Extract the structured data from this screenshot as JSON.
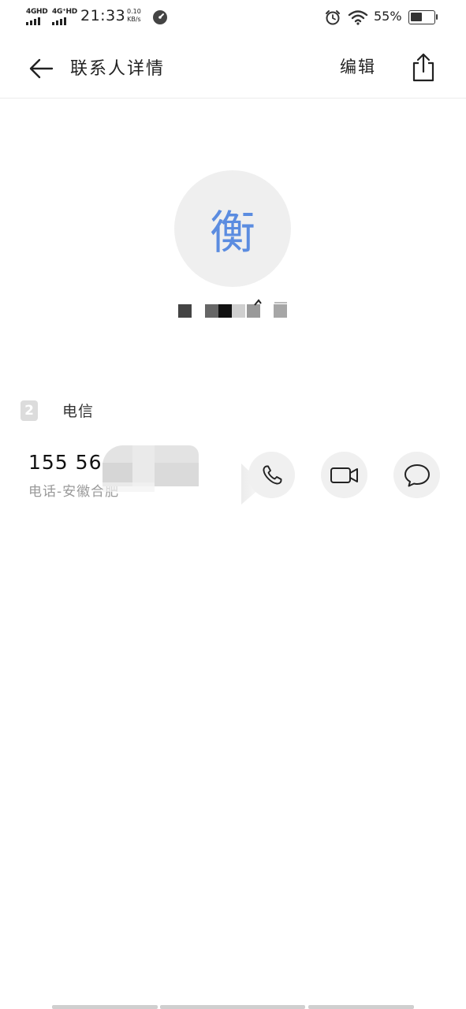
{
  "status_bar": {
    "sim1_label": "4GHD",
    "sim2_label": "4G⁺HD",
    "time": "21:33",
    "net_speed_value": "0.10",
    "net_speed_unit": "KB/s",
    "battery_percent": "55%",
    "battery_level": 0.55,
    "icons": [
      "signal-icon",
      "clock-icon",
      "alarm-icon",
      "wifi-icon",
      "battery-icon"
    ]
  },
  "header": {
    "title": "联系人详情",
    "edit_label": "编辑",
    "icons": [
      "back-arrow-icon",
      "share-icon"
    ]
  },
  "contact": {
    "avatar_char": "衡",
    "avatar_color": "#5b8ce0"
  },
  "sim": {
    "badge": "2",
    "carrier": "电信"
  },
  "phone": {
    "number": "155 56",
    "description": "电话-安徽合肥",
    "actions": [
      "phone-icon",
      "video-call-icon",
      "message-icon"
    ]
  }
}
